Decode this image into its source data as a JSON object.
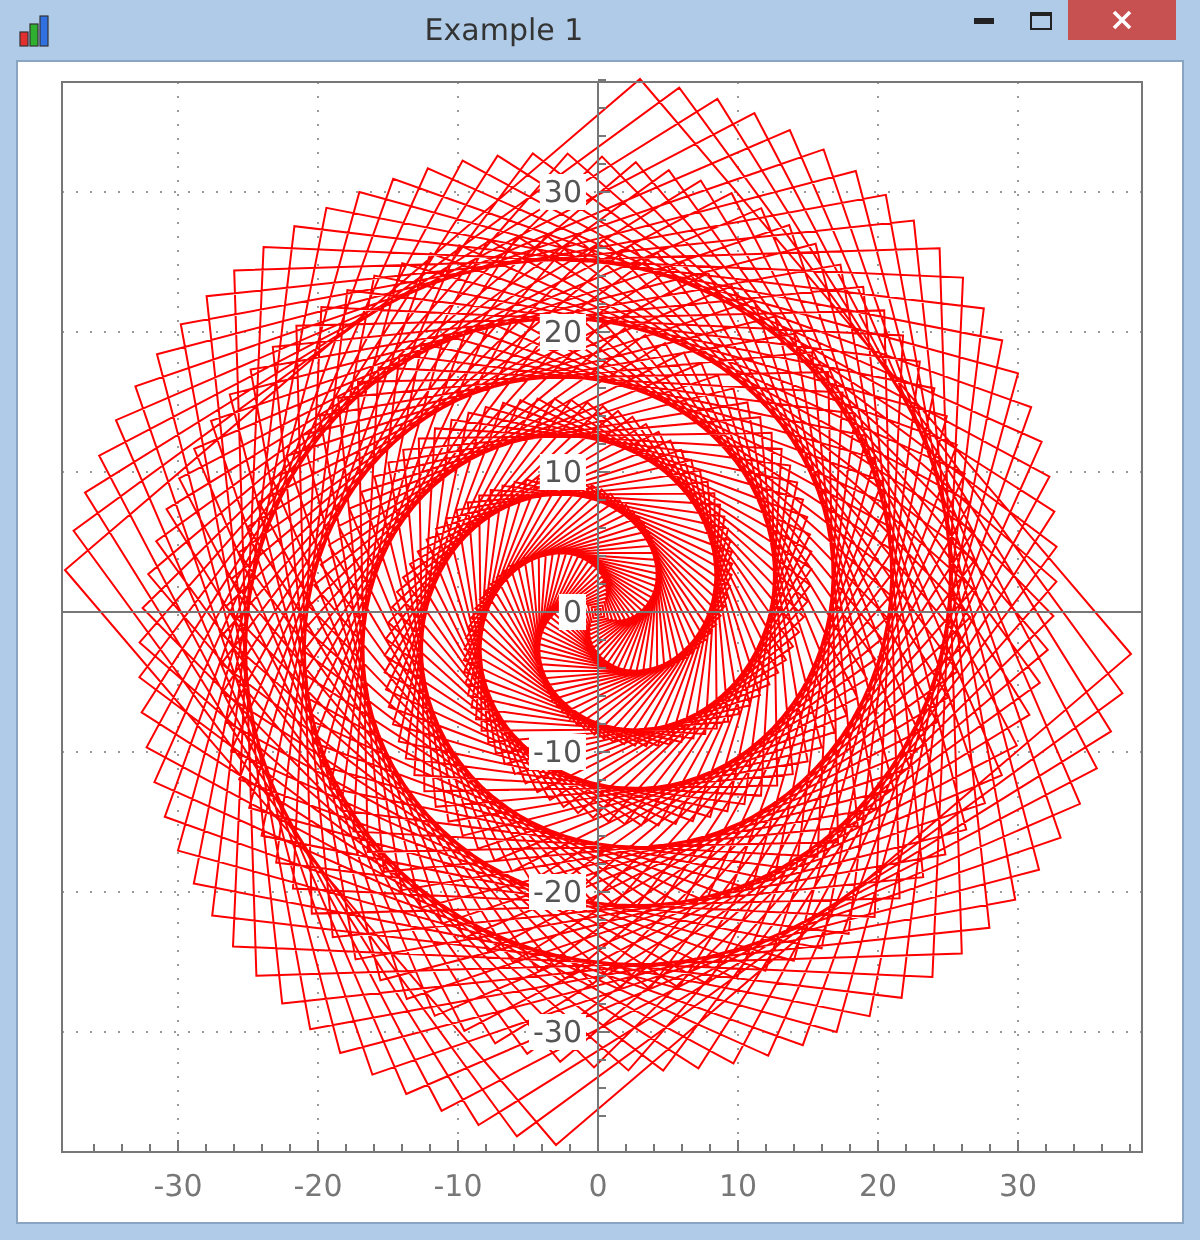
{
  "window": {
    "title": "Example 1"
  },
  "plot": {
    "x_axis": {
      "ticks": [
        "-30",
        "-20",
        "-10",
        "0",
        "10",
        "20",
        "30"
      ]
    },
    "y_axis": {
      "ticks": [
        "30",
        "20",
        "10",
        "0",
        "-10",
        "-20",
        "-30"
      ]
    }
  }
}
